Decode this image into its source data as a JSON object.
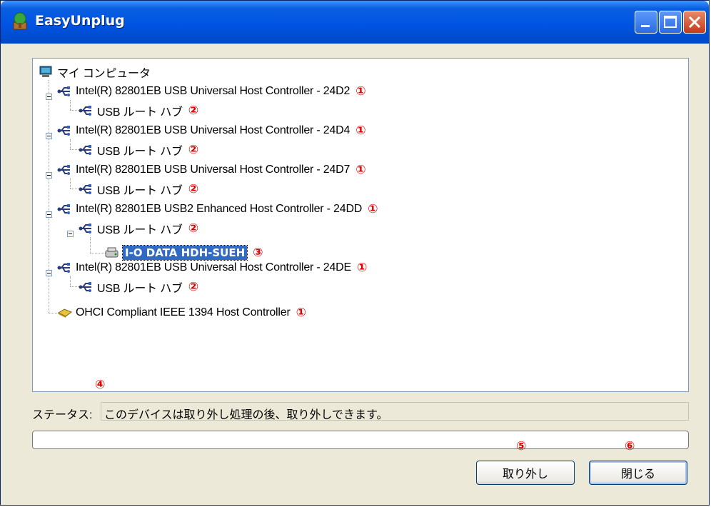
{
  "window": {
    "title": "EasyUnplug",
    "icons": {
      "app": "app-tree-icon",
      "minimize": "minimize-icon",
      "maximize": "maximize-icon",
      "close": "close-icon"
    }
  },
  "tree": {
    "root": {
      "label": "マイ コンピュータ",
      "icon": "computer-icon"
    },
    "items": [
      {
        "label": "Intel(R) 82801EB USB Universal Host Controller - 24D2",
        "marker": "①",
        "icon": "usb-icon"
      },
      {
        "label": "USB ルート ハブ",
        "marker": "②",
        "icon": "usb-icon"
      },
      {
        "label": "Intel(R) 82801EB USB Universal Host Controller - 24D4",
        "marker": "①",
        "icon": "usb-icon"
      },
      {
        "label": "USB ルート ハブ",
        "marker": "②",
        "icon": "usb-icon"
      },
      {
        "label": "Intel(R) 82801EB USB Universal Host Controller - 24D7",
        "marker": "①",
        "icon": "usb-icon"
      },
      {
        "label": "USB ルート ハブ",
        "marker": "②",
        "icon": "usb-icon"
      },
      {
        "label": "Intel(R) 82801EB USB2 Enhanced Host Controller - 24DD",
        "marker": "①",
        "icon": "usb-icon"
      },
      {
        "label": "USB ルート ハブ",
        "marker": "②",
        "icon": "usb-icon"
      },
      {
        "label": "I-O DATA HDH-SUEH",
        "marker": "③",
        "icon": "drive-icon"
      },
      {
        "label": "Intel(R) 82801EB USB Universal Host Controller - 24DE",
        "marker": "①",
        "icon": "usb-icon"
      },
      {
        "label": "USB ルート ハブ",
        "marker": "②",
        "icon": "usb-icon"
      },
      {
        "label": "OHCI Compliant IEEE 1394 Host Controller",
        "marker": "①",
        "icon": "ieee1394-icon"
      }
    ]
  },
  "status": {
    "marker": "④",
    "label": "ステータス:",
    "text": "このデバイスは取り外し処理の後、取り外しできます。"
  },
  "progress": {
    "value": 0
  },
  "buttons": {
    "remove": {
      "label": "取り外し",
      "marker": "⑤"
    },
    "close": {
      "label": "閉じる",
      "marker": "⑥"
    }
  },
  "colors": {
    "titlebar": "#0054e3",
    "selection": "#316ac5",
    "marker": "#e00000"
  }
}
